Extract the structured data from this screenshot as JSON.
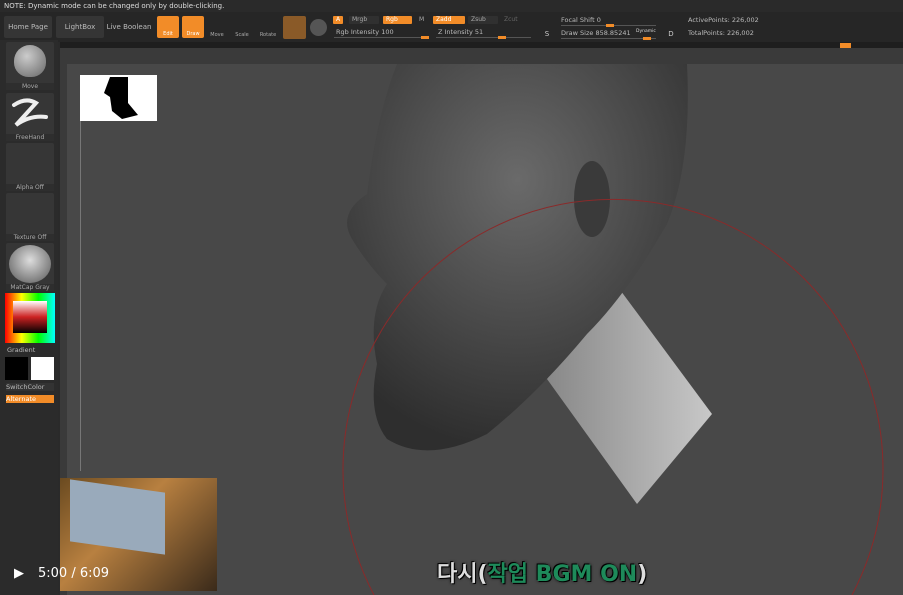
{
  "note": "NOTE: Dynamic mode can be changed only by double-clicking.",
  "toolbar": {
    "home": "Home Page",
    "lightbox": "LightBox",
    "live_boolean": "Live Boolean",
    "edit": "Edit",
    "draw": "Draw",
    "move": "Move",
    "scale": "Scale",
    "rotate": "Rotate",
    "a": "A",
    "mrgb": "Mrgb",
    "rgb": "Rgb",
    "m": "M",
    "rgb_intensity": "Rgb Intensity 100",
    "zadd": "Zadd",
    "zsub": "Zsub",
    "zcut": "Zcut",
    "z_intensity": "Z Intensity 51",
    "focal_shift": "Focal Shift 0",
    "draw_size": "Draw Size 858.85241",
    "dynamic": "Dynamic",
    "s": "S",
    "d": "D",
    "active_points": "ActivePoints: 226,002",
    "total_points": "TotalPoints: 226,002",
    "rgb_intensity_value": 100,
    "z_intensity_value": 51
  },
  "palette": {
    "move": "Move",
    "freehand": "FreeHand",
    "alpha": "Alpha Off",
    "texture": "Texture Off",
    "matcap": "MatCap Gray",
    "gradient": "Gradient",
    "switch_color": "SwitchColor",
    "alternate": "Alternate"
  },
  "player": {
    "time": "5:00 / 6:09"
  },
  "subtitle": {
    "a": "다시(",
    "b": "작업 BGM ON",
    "c": ")"
  },
  "colors": {
    "accent": "#f28c28",
    "subtitle_green": "#1e8a5a"
  }
}
